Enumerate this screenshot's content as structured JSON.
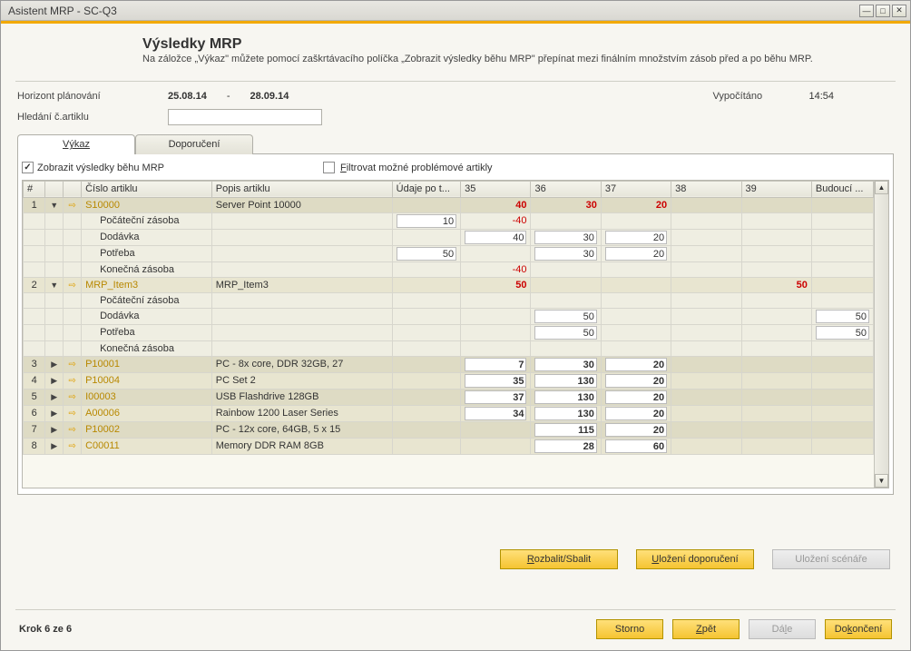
{
  "window": {
    "title": "Asistent MRP - SC-Q3"
  },
  "header": {
    "title": "Výsledky MRP",
    "desc": "Na záložce „Výkaz\" můžete pomocí zaškrtávacího políčka „Zobrazit výsledky běhu MRP\" přepínat mezi finálním množstvím zásob před a po běhu MRP."
  },
  "form": {
    "horizon_lbl": "Horizont plánování",
    "date_from": "25.08.14",
    "date_sep": "-",
    "date_to": "28.09.14",
    "calc_lbl": "Vypočítáno",
    "calc_time": "14:54",
    "search_lbl": "Hledání č.artiklu",
    "search_value": ""
  },
  "tabs": {
    "t1": "Výkaz",
    "t2": "Doporučení"
  },
  "checkboxes": {
    "show_results": "Zobrazit výsledky běhu MRP",
    "filter_problem": "Filtrovat možné problémové artikly"
  },
  "columns": {
    "num": "#",
    "art": "Číslo artiklu",
    "desc": "Popis artiklu",
    "udaj": "Údaje po t...",
    "c35": "35",
    "c36": "36",
    "c37": "37",
    "c38": "38",
    "c39": "39",
    "future": "Budoucí ..."
  },
  "sub_labels": {
    "pocat": "Počáteční zásoba",
    "dodav": "Dodávka",
    "potr": "Potřeba",
    "konec": "Konečná zásoba"
  },
  "rows": [
    {
      "n": "1",
      "exp": "▼",
      "art": "S10000",
      "desc": "Server Point 10000",
      "v35": "40",
      "v36": "30",
      "v37": "20",
      "red": true,
      "sub": [
        {
          "k": "pocat",
          "udaj": "10",
          "v35": "-40"
        },
        {
          "k": "dodav",
          "v35": "40",
          "v36": "30",
          "v37": "20"
        },
        {
          "k": "potr",
          "udaj": "50",
          "v36": "30",
          "v37": "20"
        },
        {
          "k": "konec",
          "v35": "-40"
        }
      ]
    },
    {
      "n": "2",
      "exp": "▼",
      "art": "MRP_Item3",
      "desc": "MRP_Item3",
      "v35": "50",
      "v39": "50",
      "red": true,
      "sub": [
        {
          "k": "pocat"
        },
        {
          "k": "dodav",
          "v36": "50",
          "fut": "50"
        },
        {
          "k": "potr",
          "v36": "50",
          "fut": "50"
        },
        {
          "k": "konec"
        }
      ]
    },
    {
      "n": "3",
      "exp": "▶",
      "art": "P10001",
      "desc": "PC - 8x core, DDR 32GB, 27",
      "v35": "7",
      "v36": "30",
      "v37": "20"
    },
    {
      "n": "4",
      "exp": "▶",
      "art": "P10004",
      "desc": "PC Set 2",
      "v35": "35",
      "v36": "130",
      "v37": "20"
    },
    {
      "n": "5",
      "exp": "▶",
      "art": "I00003",
      "desc": "USB Flashdrive 128GB",
      "v35": "37",
      "v36": "130",
      "v37": "20"
    },
    {
      "n": "6",
      "exp": "▶",
      "art": "A00006",
      "desc": "Rainbow 1200 Laser Series",
      "v35": "34",
      "v36": "130",
      "v37": "20"
    },
    {
      "n": "7",
      "exp": "▶",
      "art": "P10002",
      "desc": "PC - 12x core, 64GB, 5 x 15",
      "v36": "115",
      "v37": "20"
    },
    {
      "n": "8",
      "exp": "▶",
      "art": "C00011",
      "desc": "Memory DDR RAM 8GB",
      "v36": "28",
      "v37": "60"
    }
  ],
  "buttons": {
    "expand": "Rozbalit/Sbalit",
    "save_rec": "Uložení doporučení",
    "save_scen": "Uložení scénáře",
    "cancel": "Storno",
    "back": "Zpět",
    "next": "Dále",
    "finish": "Dokončení"
  },
  "step": "Krok 6 ze 6"
}
